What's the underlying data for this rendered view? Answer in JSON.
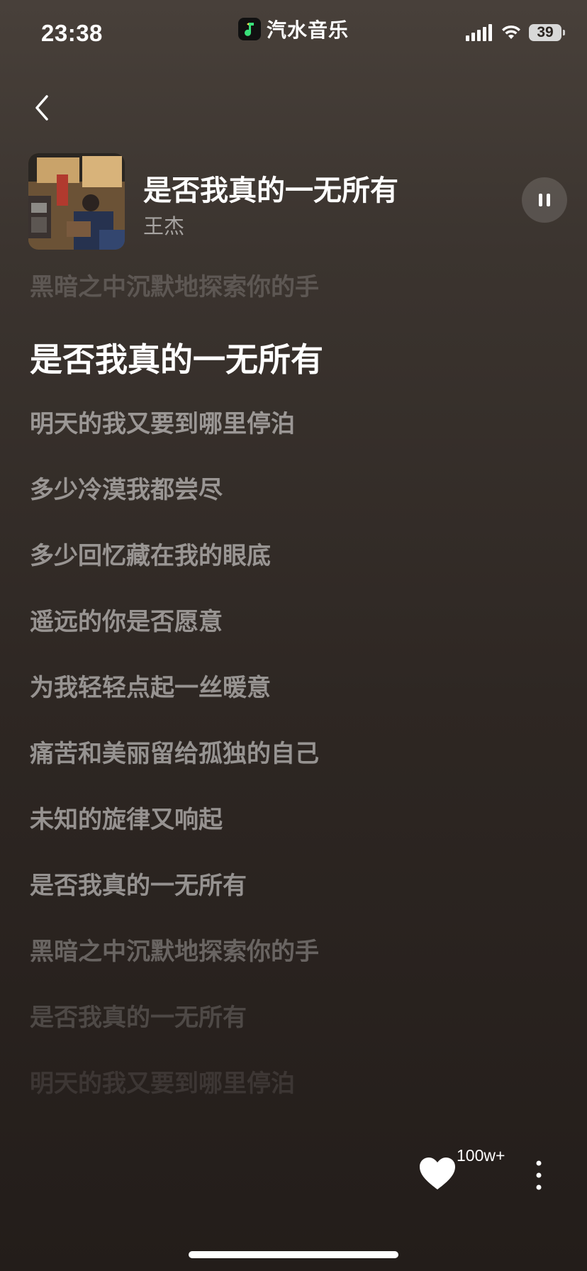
{
  "status_bar": {
    "time": "23:38",
    "app_name": "汽水音乐",
    "battery": "39"
  },
  "now_playing": {
    "title": "是否我真的一无所有",
    "artist": "王杰",
    "state": "playing"
  },
  "lyrics": {
    "lines": [
      "黑暗之中沉默地探索你的手",
      "是否我真的一无所有",
      "明天的我又要到哪里停泊",
      "多少冷漠我都尝尽",
      "多少回忆藏在我的眼底",
      "遥远的你是否愿意",
      "为我轻轻点起一丝暖意",
      "痛苦和美丽留给孤独的自己",
      "未知的旋律又响起",
      "是否我真的一无所有",
      "黑暗之中沉默地探索你的手",
      "是否我真的一无所有",
      "明天的我又要到哪里停泊"
    ],
    "active_index": 1
  },
  "actions": {
    "like_count": "100w+"
  },
  "icons": {
    "back": "chevron-left-icon",
    "pause": "pause-icon",
    "like": "heart-icon",
    "more": "more-vertical-icon",
    "wifi": "wifi-icon",
    "signal": "signal-icon",
    "app_logo": "music-note-icon"
  },
  "colors": {
    "background_top": "#48403a",
    "background_bottom": "#231d1a",
    "active_lyric": "#ffffff",
    "app_logo_accent": "#39e07a"
  }
}
